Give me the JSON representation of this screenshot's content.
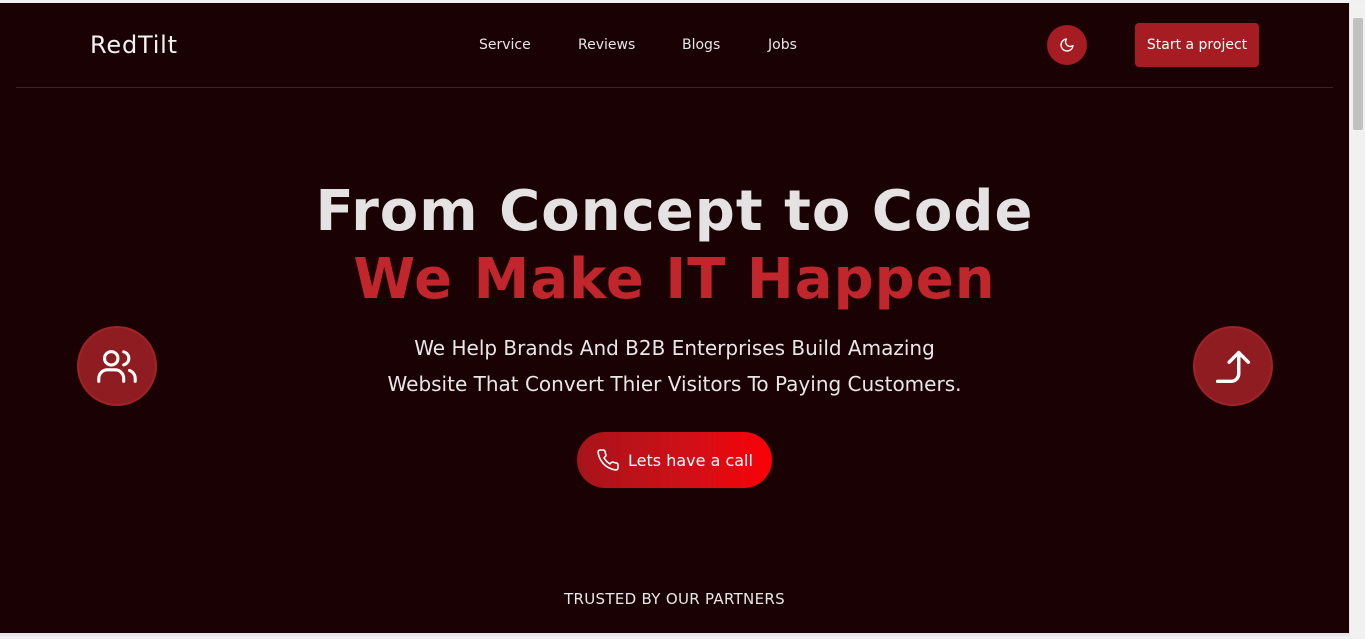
{
  "header": {
    "logo": "RedTilt",
    "nav": [
      {
        "label": "Service"
      },
      {
        "label": "Reviews"
      },
      {
        "label": "Blogs"
      },
      {
        "label": "Jobs"
      }
    ],
    "theme_toggle_icon": "moon-icon",
    "cta_label": "Start a project"
  },
  "hero": {
    "title_line1": "From Concept to Code",
    "title_line2": "We Make IT Happen",
    "subtitle_line1": "We Help Brands And B2B Enterprises Build Amazing",
    "subtitle_line2": "Website That Convert Thier Visitors To Paying Customers.",
    "call_button": {
      "label": "Lets have a call",
      "icon": "phone-icon"
    },
    "left_badge_icon": "users-icon",
    "right_badge_icon": "arrow-turn-up-icon"
  },
  "partners": {
    "heading": "TRUSTED BY OUR PARTNERS"
  },
  "colors": {
    "background": "#1a0204",
    "accent": "#a51c22",
    "title_red": "#c1262c",
    "text": "#e4e2e2"
  }
}
